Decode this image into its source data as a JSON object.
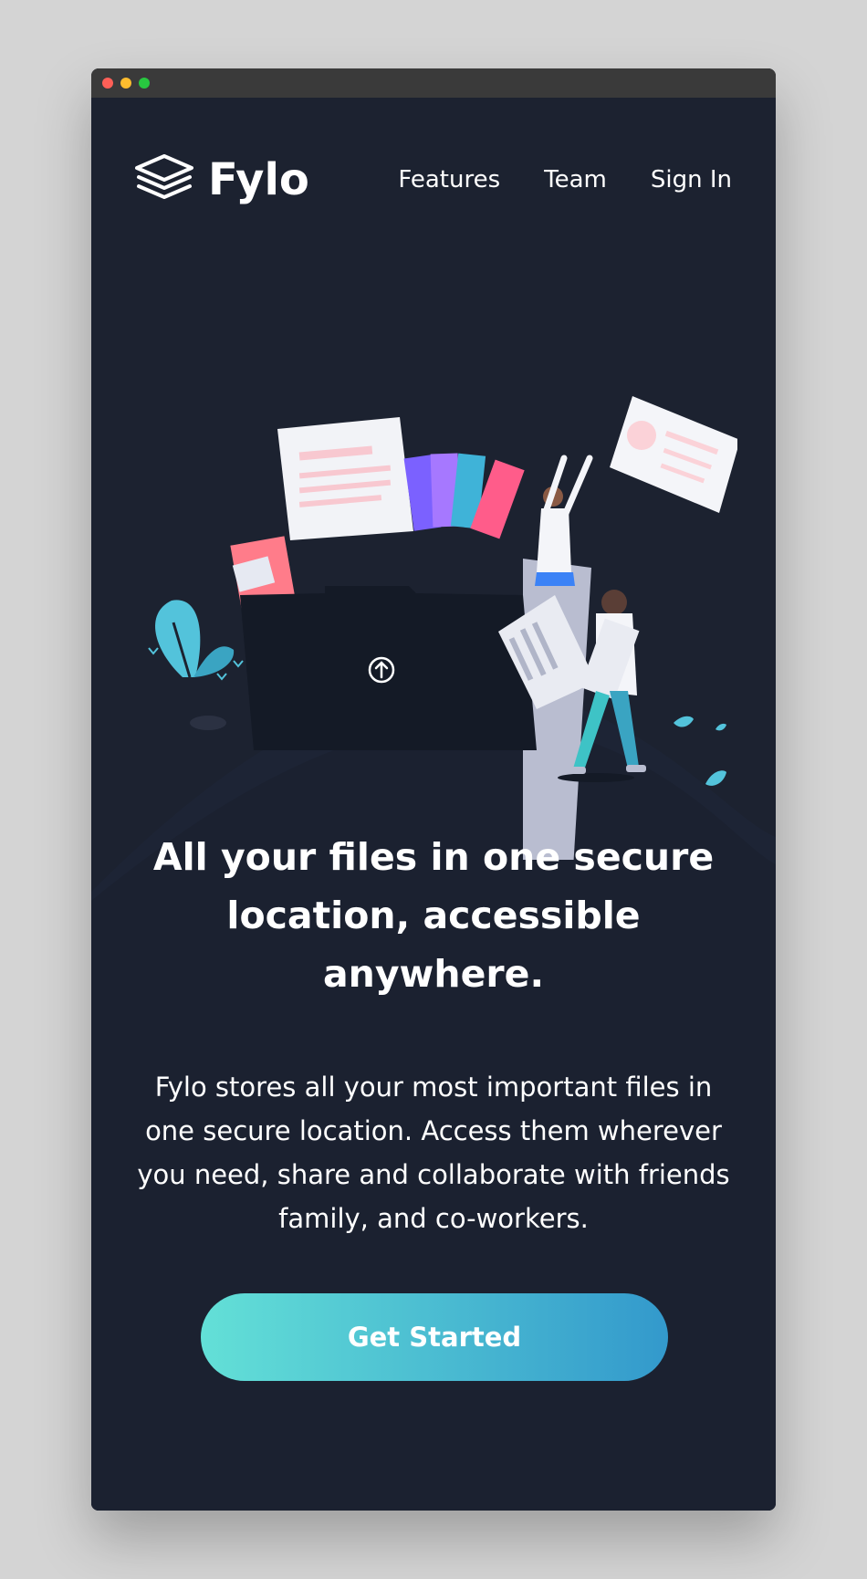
{
  "brand": {
    "name": "Fylo",
    "logo_icon": "stacked-layers-icon"
  },
  "nav": {
    "items": [
      {
        "label": "Features"
      },
      {
        "label": "Team"
      },
      {
        "label": "Sign In"
      }
    ]
  },
  "hero": {
    "headline": "All your files in one secure location, accessible anywhere.",
    "description": "Fylo stores all your most important files in one secure location. Access them wherever you need, share and collaborate with friends family, and co-workers.",
    "cta_label": "Get Started",
    "illustration_icon": "upload-arrow-icon"
  },
  "colors": {
    "background": "#1c2230",
    "cta_gradient_start": "#63e0d7",
    "cta_gradient_end": "#3399cc",
    "text": "#ffffff"
  }
}
